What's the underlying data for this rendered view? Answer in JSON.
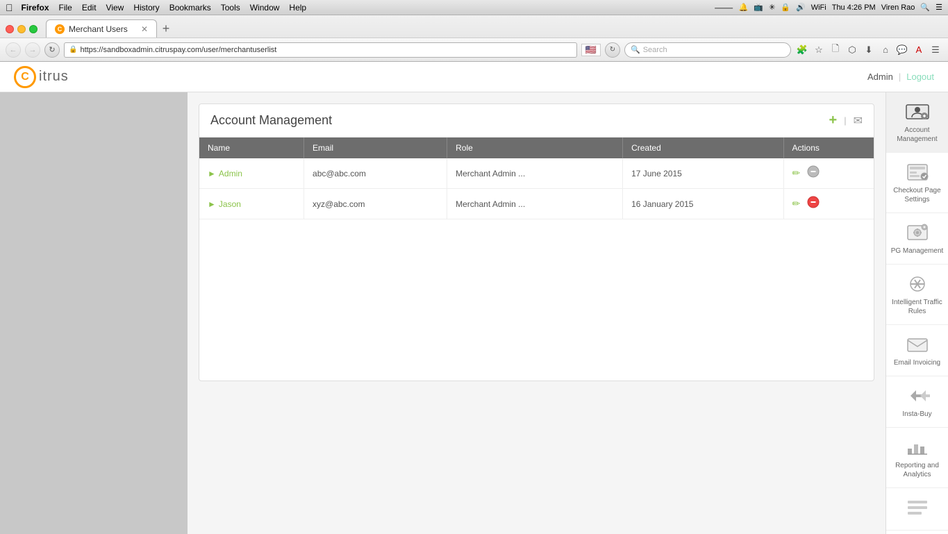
{
  "menubar": {
    "apple": "&#63743;",
    "items": [
      "Firefox",
      "File",
      "Edit",
      "View",
      "History",
      "Bookmarks",
      "Tools",
      "Window",
      "Help"
    ],
    "time": "Thu 4:26 PM",
    "user": "Viren Rao"
  },
  "browser": {
    "tab_label": "Merchant Users",
    "address": "https://sandboxadmin.citruspay.com/user/merchantuserlist",
    "search_placeholder": "Search"
  },
  "header": {
    "logo_letter": "C",
    "logo_text": "itrus",
    "admin_label": "Admin",
    "logout_label": "Logout"
  },
  "panel": {
    "title": "Account Management",
    "add_label": "+",
    "pipe": "|",
    "email_icon": "✉"
  },
  "table": {
    "columns": [
      "Name",
      "Email",
      "Role",
      "Created",
      "Actions"
    ],
    "rows": [
      {
        "name": "Admin",
        "email": "abc@abc.com",
        "role": "Merchant Admin ...",
        "created": "17 June 2015",
        "can_delete": false
      },
      {
        "name": "Jason",
        "email": "xyz@abc.com",
        "role": "Merchant Admin ...",
        "created": "16 January 2015",
        "can_delete": true
      }
    ]
  },
  "sidebar": {
    "items": [
      {
        "label": "Account Management",
        "icon": "account",
        "active": true
      },
      {
        "label": "Checkout Page Settings",
        "icon": "checkout",
        "active": false
      },
      {
        "label": "PG Management",
        "icon": "pg",
        "active": false
      },
      {
        "label": "Intelligent Traffic Rules",
        "icon": "traffic",
        "active": false
      },
      {
        "label": "Email Invoicing",
        "icon": "email",
        "active": false
      },
      {
        "label": "Insta-Buy",
        "icon": "instabuy",
        "active": false
      },
      {
        "label": "Reporting and Analytics",
        "icon": "reporting",
        "active": false
      },
      {
        "label": "",
        "icon": "misc",
        "active": false
      }
    ]
  }
}
